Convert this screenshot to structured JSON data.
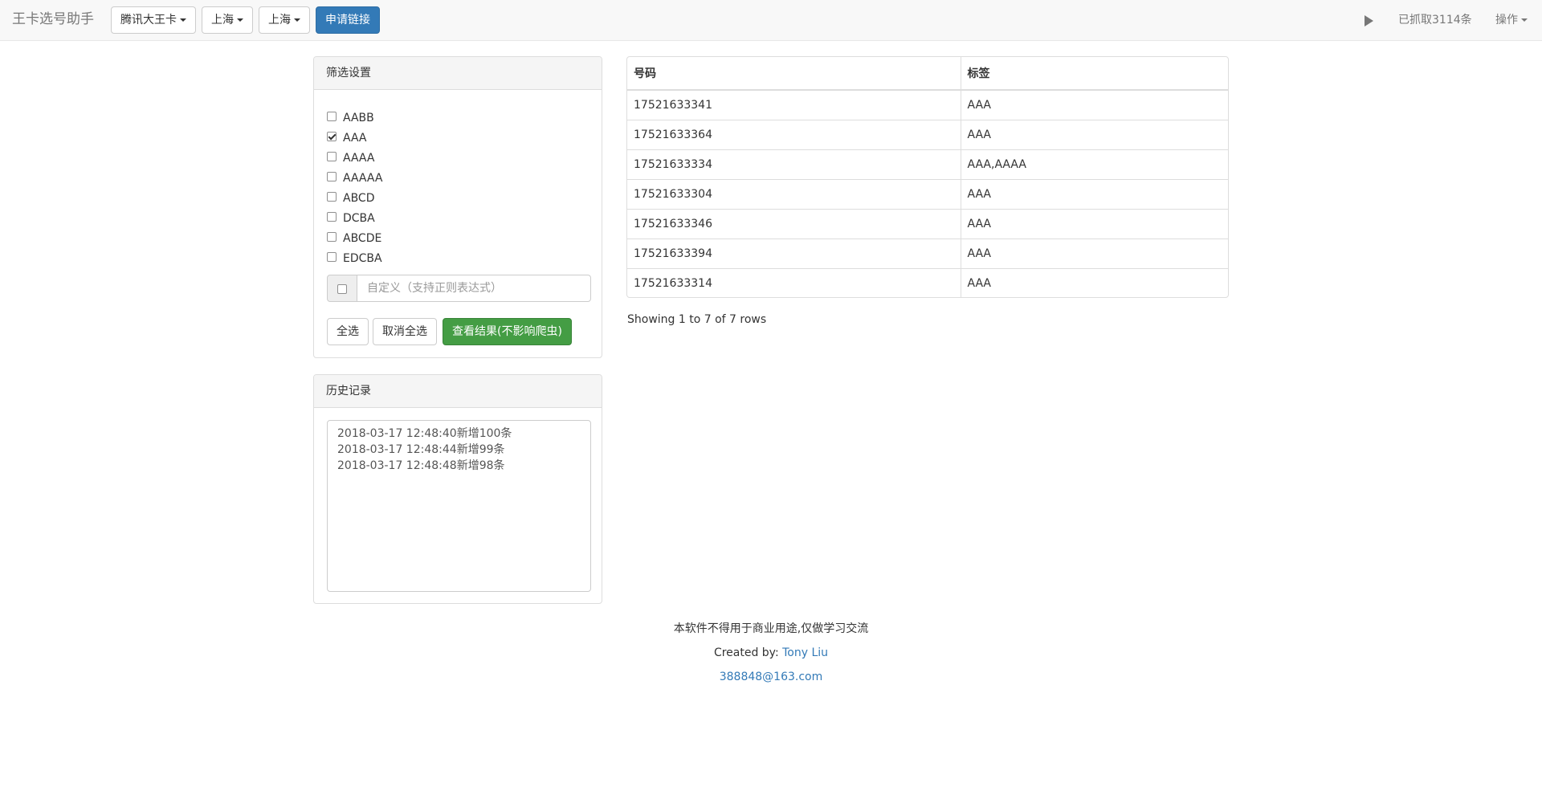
{
  "navbar": {
    "brand": "王卡选号助手",
    "card_dropdown": "腾讯大王卡",
    "province_dropdown": "上海",
    "city_dropdown": "上海",
    "apply_link_button": "申请链接",
    "captured_count": "已抓取3114条",
    "actions_menu": "操作"
  },
  "filter_panel": {
    "title": "筛选设置",
    "options": [
      {
        "label": "AABB",
        "checked": false
      },
      {
        "label": "AAA",
        "checked": true
      },
      {
        "label": "AAAA",
        "checked": false
      },
      {
        "label": "AAAAA",
        "checked": false
      },
      {
        "label": "ABCD",
        "checked": false
      },
      {
        "label": "DCBA",
        "checked": false
      },
      {
        "label": "ABCDE",
        "checked": false
      },
      {
        "label": "EDCBA",
        "checked": false
      }
    ],
    "custom_placeholder": "自定义（支持正则表达式）",
    "select_all_button": "全选",
    "deselect_all_button": "取消全选",
    "view_results_button": "查看结果(不影响爬虫)"
  },
  "history_panel": {
    "title": "历史记录",
    "entries": [
      "2018-03-17 12:48:40新增100条",
      "2018-03-17 12:48:44新增99条",
      "2018-03-17 12:48:48新增98条"
    ]
  },
  "results_table": {
    "columns": [
      "号码",
      "标签"
    ],
    "rows": [
      [
        "17521633341",
        "AAA"
      ],
      [
        "17521633364",
        "AAA"
      ],
      [
        "17521633334",
        "AAA,AAAA"
      ],
      [
        "17521633304",
        "AAA"
      ],
      [
        "17521633346",
        "AAA"
      ],
      [
        "17521633394",
        "AAA"
      ],
      [
        "17521633314",
        "AAA"
      ]
    ],
    "pagination_info": "Showing 1 to 7 of 7 rows"
  },
  "footer": {
    "disclaimer": "本软件不得用于商业用途,仅做学习交流",
    "created_by_label": "Created by: ",
    "author": "Tony Liu",
    "email": "388848@163.com"
  },
  "colors": {
    "primary": "#337ab7",
    "success": "#449d44",
    "navbar_bg": "#f8f8f8",
    "panel_heading_bg": "#f5f5f5"
  },
  "icons": {
    "play": "play-icon",
    "caret": "caret-down-icon"
  }
}
